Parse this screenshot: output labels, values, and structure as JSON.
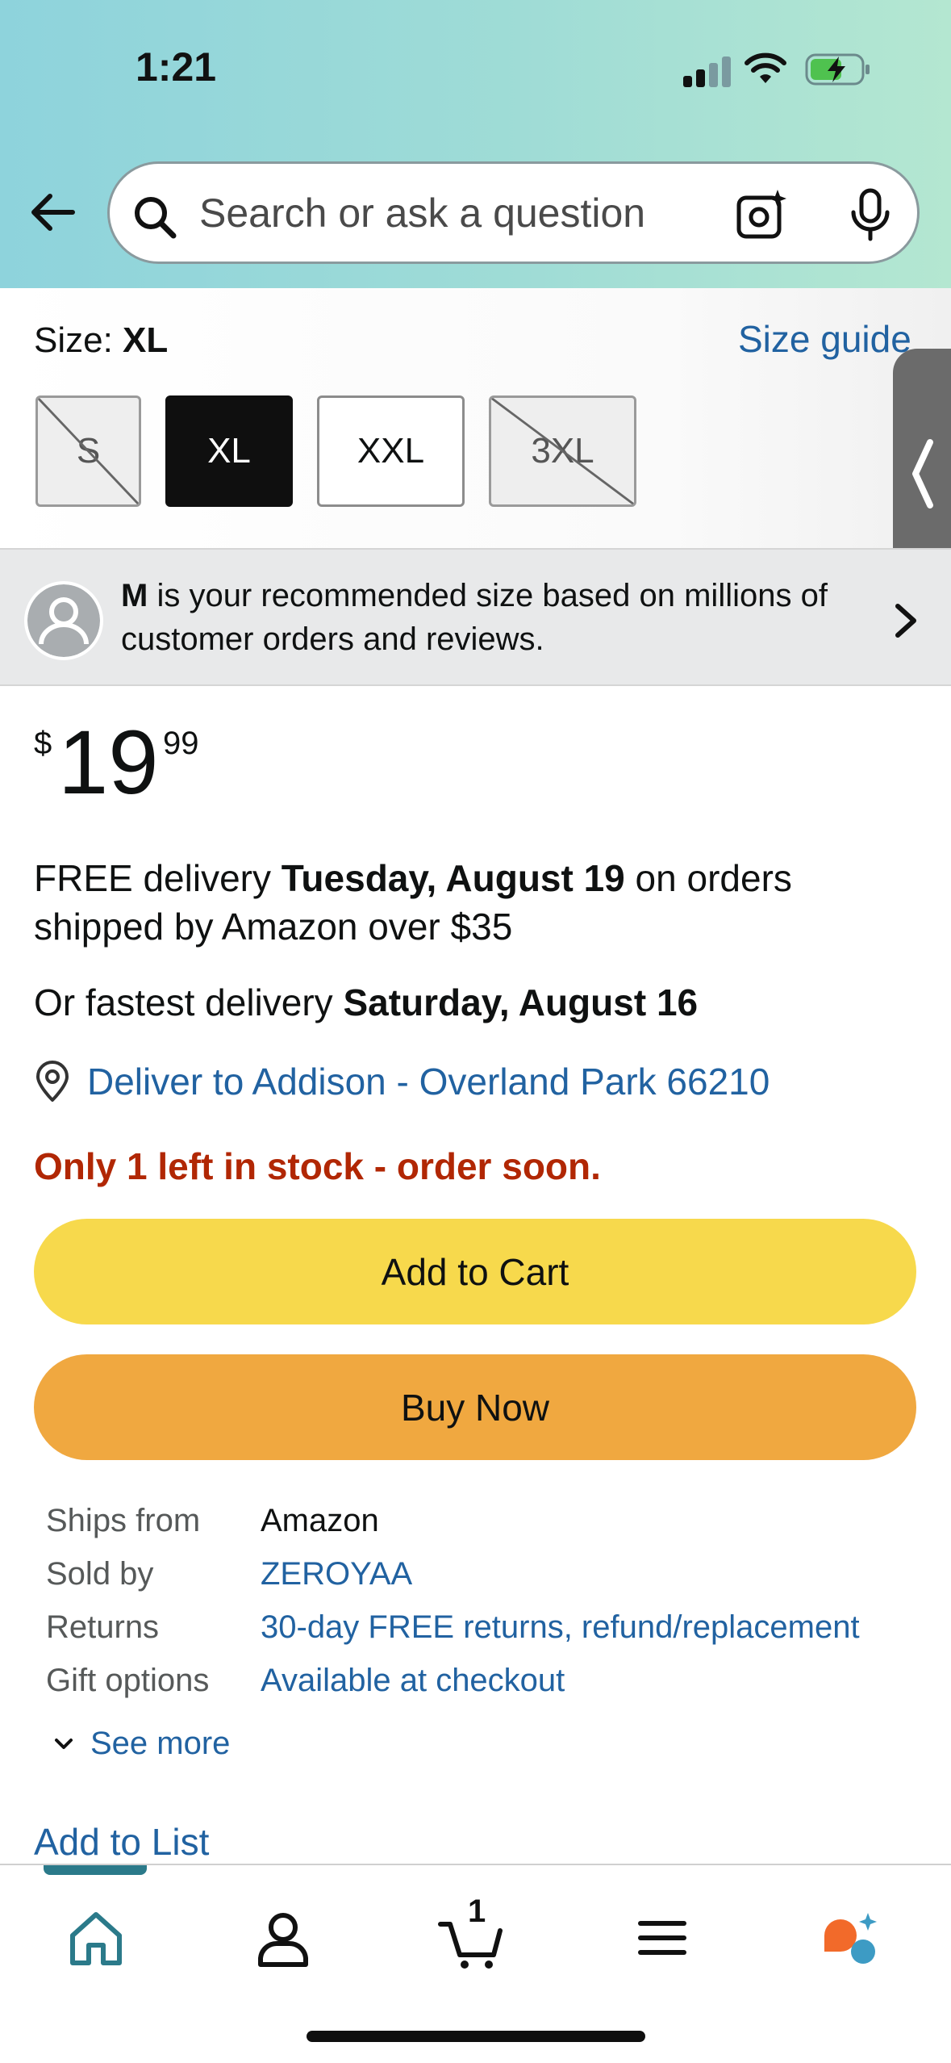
{
  "status_bar": {
    "time": "1:21"
  },
  "header": {
    "search_placeholder": "Search or ask a question",
    "gradient_colors": [
      "#8ed3dc",
      "#b4e7d1"
    ]
  },
  "size": {
    "label": "Size: ",
    "selected": "XL",
    "guide_link": "Size guide",
    "options": [
      {
        "label": "S",
        "state": "unavailable"
      },
      {
        "label": "XL",
        "state": "selected"
      },
      {
        "label": "XXL",
        "state": "available"
      },
      {
        "label": "3XL",
        "state": "unavailable"
      }
    ]
  },
  "recommendation": {
    "size": "M",
    "text": " is your recommended size based on millions of customer orders and reviews."
  },
  "price": {
    "symbol": "$",
    "whole": "19",
    "fraction": "99"
  },
  "delivery": {
    "prefix": "FREE delivery ",
    "date": "Tuesday, August 19",
    "suffix": " on orders shipped by Amazon over $35",
    "fastest_prefix": "Or fastest delivery ",
    "fastest_date": "Saturday, August 16",
    "deliver_to": "Deliver to Addison - Overland Park 66210"
  },
  "stock": {
    "message": "Only 1 left in stock - order soon.",
    "color": "#b12704"
  },
  "buttons": {
    "add_to_cart": "Add to Cart",
    "buy_now": "Buy Now",
    "add_to_cart_color": "#f7d94c",
    "buy_now_color": "#f0a840"
  },
  "info": [
    {
      "key": "Ships from",
      "value": "Amazon",
      "link": false
    },
    {
      "key": "Sold by",
      "value": "ZEROYAA",
      "link": true
    },
    {
      "key": "Returns",
      "value": "30-day FREE returns, refund/replacement",
      "link": true
    },
    {
      "key": "Gift options",
      "value": "Available at checkout",
      "link": true
    }
  ],
  "see_more": "See more",
  "add_to_list": "Add to List",
  "bottom_nav": {
    "items": [
      "home-icon",
      "account-icon",
      "cart-icon",
      "menu-icon",
      "rufus-icon"
    ],
    "cart_count": "1",
    "active": "home"
  },
  "colors": {
    "link": "#2162a1",
    "accent_teal": "#2b7a8a"
  }
}
